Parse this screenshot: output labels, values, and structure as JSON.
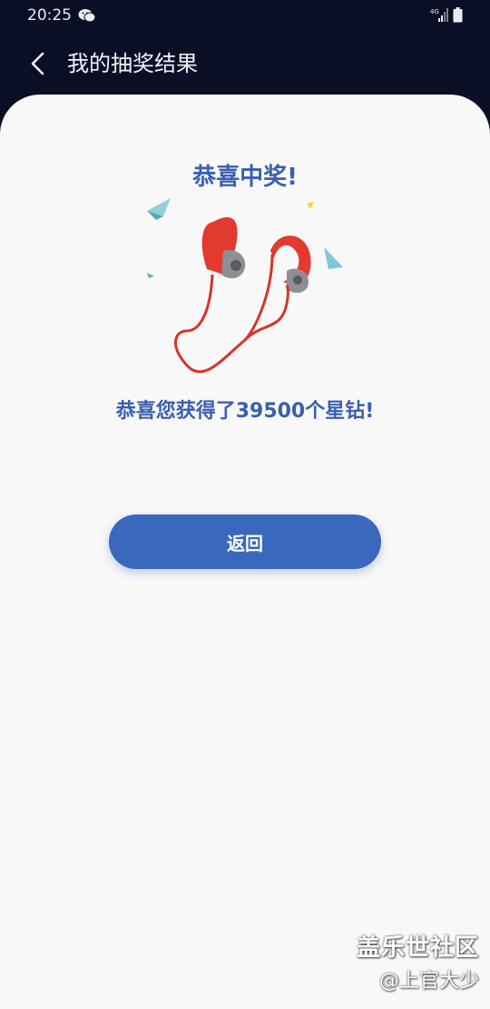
{
  "status_bar": {
    "time": "20:25",
    "network": "4G"
  },
  "app_bar": {
    "title": "我的抽奖结果"
  },
  "result": {
    "title": "恭喜中奖!",
    "message": "恭喜您获得了39500个星钻!",
    "prize_icon": "red-earphones-image"
  },
  "actions": {
    "back_label": "返回"
  },
  "watermark": {
    "brand": "盖乐世社区",
    "user": "@上官大少"
  },
  "colors": {
    "header_bg": "#0b0f26",
    "accent": "#3a68bd",
    "title_text": "#3a5fae",
    "card_bg": "#f8f8f9"
  }
}
